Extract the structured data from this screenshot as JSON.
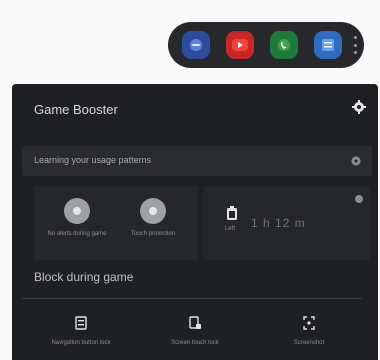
{
  "app_bar": {
    "apps": [
      {
        "icon": "game-launcher-icon",
        "color": "#3a5fb8"
      },
      {
        "icon": "youtube-icon",
        "color": "#e53935"
      },
      {
        "icon": "whatsapp-icon",
        "color": "#2e9b4e"
      },
      {
        "icon": "calculator-icon",
        "color": "#3f7fd1"
      }
    ]
  },
  "panel": {
    "title": "Game Booster",
    "notice": "Learning your usage patterns",
    "toggles": [
      {
        "label": "No alerts during game"
      },
      {
        "label": "Touch protection"
      }
    ],
    "battery": {
      "label": "Left",
      "time": "1 h 12 m"
    },
    "section_title": "Block during game",
    "bottom_items": [
      {
        "icon": "navigation-button-icon",
        "label": "Navigation button lock"
      },
      {
        "icon": "screen-lock-icon",
        "label": "Screen touch lock"
      },
      {
        "icon": "screenshot-icon",
        "label": "Screenshot"
      }
    ]
  }
}
